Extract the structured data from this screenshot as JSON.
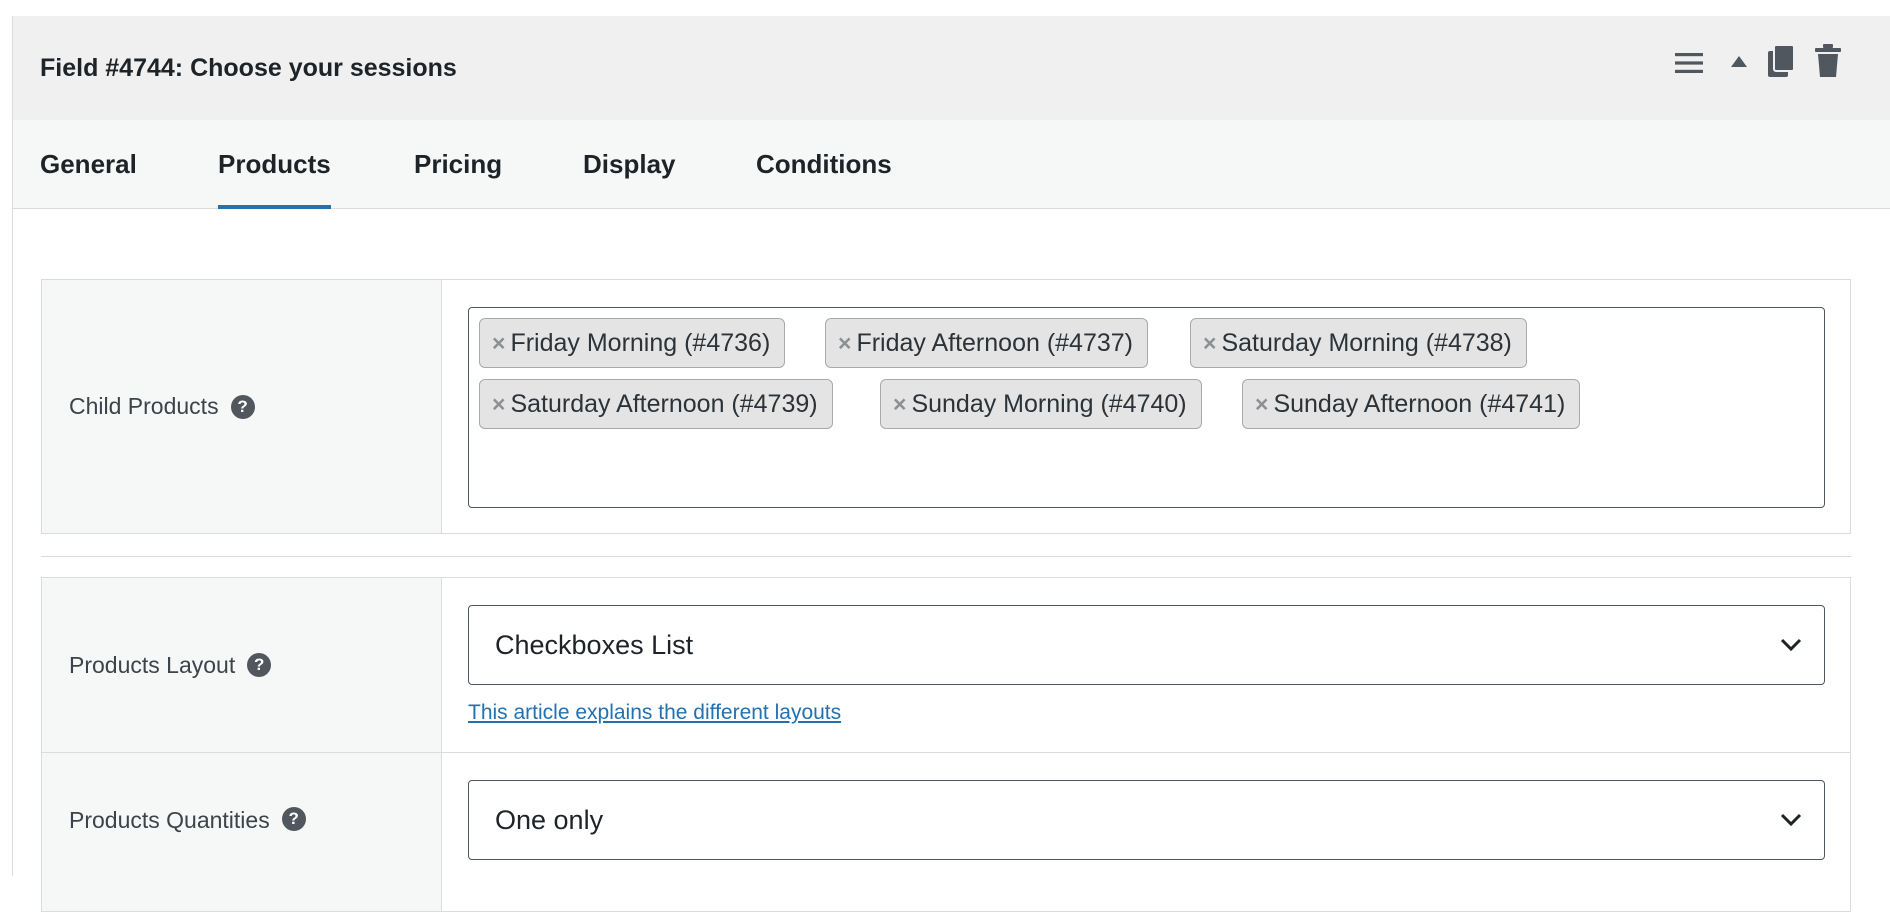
{
  "header": {
    "title": "Field #4744: Choose your sessions",
    "actions": [
      {
        "icon": "menu-icon"
      },
      {
        "icon": "collapse-arrow-icon"
      },
      {
        "icon": "duplicate-icon"
      },
      {
        "icon": "trash-icon"
      }
    ]
  },
  "tabs": [
    {
      "label": "General",
      "active": false
    },
    {
      "label": "Products",
      "active": true
    },
    {
      "label": "Pricing",
      "active": false
    },
    {
      "label": "Display",
      "active": false
    },
    {
      "label": "Conditions",
      "active": false
    }
  ],
  "fields": {
    "child_products": {
      "label": "Child Products",
      "help": "?",
      "chips": [
        "Friday Morning (#4736)",
        "Friday Afternoon (#4737)",
        "Saturday Morning (#4738)",
        "Saturday Afternoon (#4739)",
        "Sunday Morning (#4740)",
        "Sunday Afternoon (#4741)"
      ],
      "remove_glyph": "×"
    },
    "products_layout": {
      "label": "Products Layout",
      "help": "?",
      "value": "Checkboxes List",
      "link_text": "This article explains the different layouts"
    },
    "products_quantities": {
      "label": "Products Quantities",
      "help": "?",
      "value": "One only"
    }
  },
  "colors": {
    "accent": "#2271b1",
    "header_bg": "#f0f0f1",
    "label_bg": "#f6f7f7",
    "chip_bg": "#e4e4e4"
  }
}
